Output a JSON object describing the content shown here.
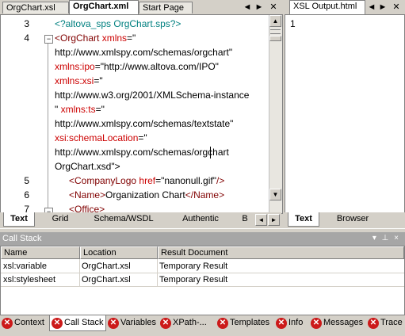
{
  "editor": {
    "tabs": [
      {
        "label": "OrgChart.xsl"
      },
      {
        "label": "OrgChart.xml"
      },
      {
        "label": "Start Page"
      }
    ],
    "lines": [
      {
        "num": "3"
      },
      {
        "num": "4"
      },
      {
        "num": "5"
      },
      {
        "num": "6"
      },
      {
        "num": "7"
      }
    ],
    "code": {
      "l3": "<?altova_sps OrgChart.sps?>",
      "l4_tag": "<OrgChart",
      "l4_attr": "xmlns",
      "l4_eq": "=\"",
      "w1": "http://www.xmlspy.com/schemas/orgchart\"",
      "w2_attr": "xmlns:ipo",
      "w2_val": "=\"http://www.altova.com/IPO\"",
      "w3_attr": "xmlns:xsi",
      "w3_val": "=\"",
      "w4": "http://www.w3.org/2001/XMLSchema-instance",
      "w5_val": "\"",
      "w5_attr": " xmlns:ts",
      "w5_eq": "=\"",
      "w6": "http://www.xmlspy.com/schemas/textstate\"",
      "w7_attr": "xsi:schemaLocation",
      "w7_eq": "=\"",
      "w8": "http://www.xmlspy.com/schemas/orgchart",
      "w9": "OrgChart.xsd\">",
      "l5_tag": "<CompanyLogo",
      "l5_attr": " href",
      "l5_val": "=\"nanonull.gif\"",
      "l5_end": "/>",
      "l6_open": "<Name>",
      "l6_text": "Organization Chart",
      "l6_close": "</Name>",
      "l7_tag": "<Office>"
    },
    "view_tabs": [
      {
        "label": "Text"
      },
      {
        "label": "Grid"
      },
      {
        "label": "Schema/WSDL"
      },
      {
        "label": "Authentic"
      },
      {
        "label": "B"
      }
    ],
    "controls": {
      "left": "◄",
      "right": "►",
      "close": "✕"
    }
  },
  "output": {
    "tab": "XSL Output.html",
    "line": "1",
    "view_tabs": [
      {
        "label": "Text"
      },
      {
        "label": "Browser"
      }
    ]
  },
  "callstack": {
    "title": "Call Stack",
    "pin": "▾ ⊥ ×",
    "columns": [
      "Name",
      "Location",
      "Result Document"
    ],
    "rows": [
      {
        "name": "xsl:variable",
        "location": "OrgChart.xsl",
        "result": "Temporary Result"
      },
      {
        "name": "xsl:stylesheet",
        "location": "OrgChart.xsl",
        "result": "Temporary Result"
      }
    ]
  },
  "bottom_tabs": [
    {
      "label": "Context"
    },
    {
      "label": "Call Stack"
    },
    {
      "label": "Variables"
    },
    {
      "label": "XPath-..."
    },
    {
      "label": "Templates"
    },
    {
      "label": "Info"
    },
    {
      "label": "Messages"
    },
    {
      "label": "Trace"
    }
  ],
  "colors": {
    "tag": "#800000",
    "attribute": "#cc0000",
    "processing_instruction": "#008080",
    "chrome": "#d4d0c8"
  }
}
